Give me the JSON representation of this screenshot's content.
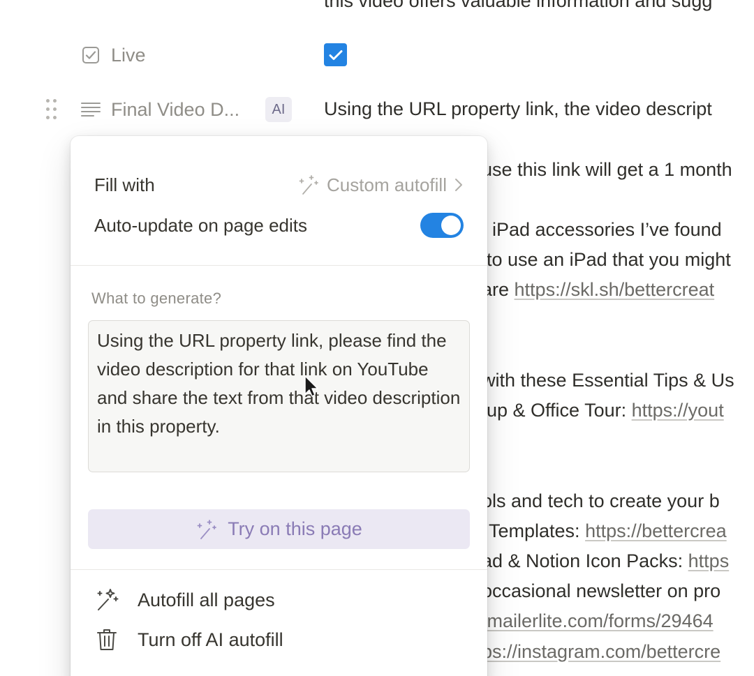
{
  "background": {
    "top_fragment": "this video offers valuable information and sugg",
    "properties": {
      "live": {
        "label": "Live",
        "icon": "checkbox-icon",
        "checked": true
      },
      "final_description": {
        "label": "Final Video D...",
        "icon": "text-lines-icon",
        "badge": "AI",
        "value": "Using the URL property link, the video descript"
      }
    },
    "content_lines": [
      "use this link will get a 1 month",
      "t iPad accessories I’ve found",
      "to use an iPad that you might",
      "are ",
      "with these Essential Tips & Us",
      "up & Office Tour: ",
      "ols and tech to create your b",
      "Templates: ",
      "ad & Notion Icon Packs: ",
      "occasional newsletter on pro",
      ".mailerlite.com/forms/29464",
      "ps://instagram.com/bettercre"
    ],
    "links": {
      "skl": "https://skl.sh/bettercreat",
      "youtube": "https://yout",
      "templates": "https://bettercrea",
      "icon_packs": "https"
    }
  },
  "popup": {
    "fill_with_label": "Fill with",
    "fill_with_value": "Custom autofill",
    "auto_update_label": "Auto-update on page edits",
    "auto_update_on": true,
    "prompt_title": "What to generate?",
    "prompt_text": "Using the URL property link, please find the video description for that link on YouTube and share the text from that video description in this property.",
    "try_button": "Try on this page",
    "menu": [
      {
        "label": "Autofill all pages",
        "icon": "sparkles-icon"
      },
      {
        "label": "Turn off AI autofill",
        "icon": "trash-icon"
      }
    ]
  },
  "colors": {
    "accent": "#2383e2",
    "ai_purple": "#8a7bb5",
    "muted": "#8f8d87"
  }
}
